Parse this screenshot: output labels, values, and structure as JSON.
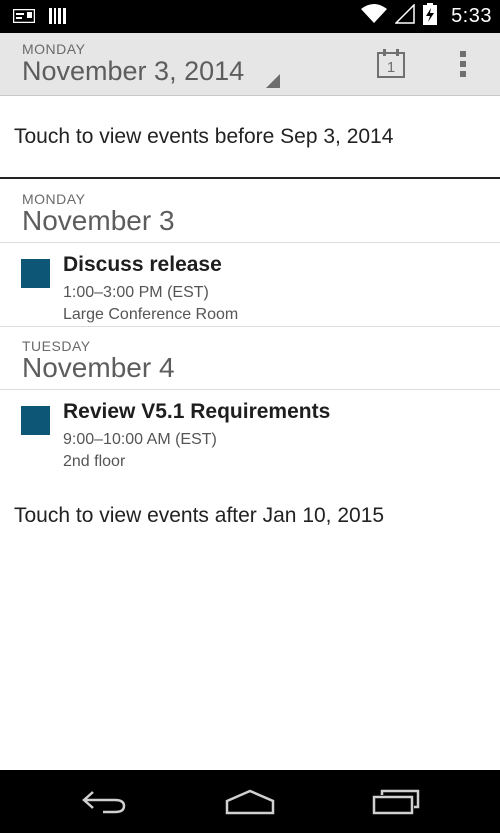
{
  "status_bar": {
    "time": "5:33",
    "left_icons": [
      "notification-message-icon",
      "notification-barcode-icon"
    ],
    "right_icons": [
      "wifi-icon",
      "signal-icon",
      "battery-charging-icon"
    ]
  },
  "action_bar": {
    "day_label": "MONDAY",
    "date_label": "November 3, 2014",
    "today_icon_number": "1",
    "icons": [
      "calendar-today-icon",
      "overflow-menu-icon"
    ]
  },
  "agenda": {
    "load_before": "Touch to view events before Sep 3, 2014",
    "days": [
      {
        "day_label": "MONDAY",
        "date_label": "November 3",
        "events": [
          {
            "title": "Discuss release",
            "time": "1:00–3:00 PM (EST)",
            "location": "Large Conference Room",
            "color": "#0d5676"
          }
        ]
      },
      {
        "day_label": "TUESDAY",
        "date_label": "November 4",
        "events": [
          {
            "title": "Review V5.1 Requirements",
            "time": "9:00–10:00 AM (EST)",
            "location": "2nd floor",
            "color": "#0d5676"
          }
        ]
      }
    ],
    "load_after": "Touch to view events after Jan 10, 2015"
  },
  "nav_bar": {
    "icons": [
      "back-icon",
      "home-icon",
      "recent-apps-icon"
    ]
  },
  "colors": {
    "status_bar_bg": "#000000",
    "action_bar_bg": "#e6e6e6",
    "event_color": "#0d5676",
    "nav_bar_bg": "#000000"
  }
}
